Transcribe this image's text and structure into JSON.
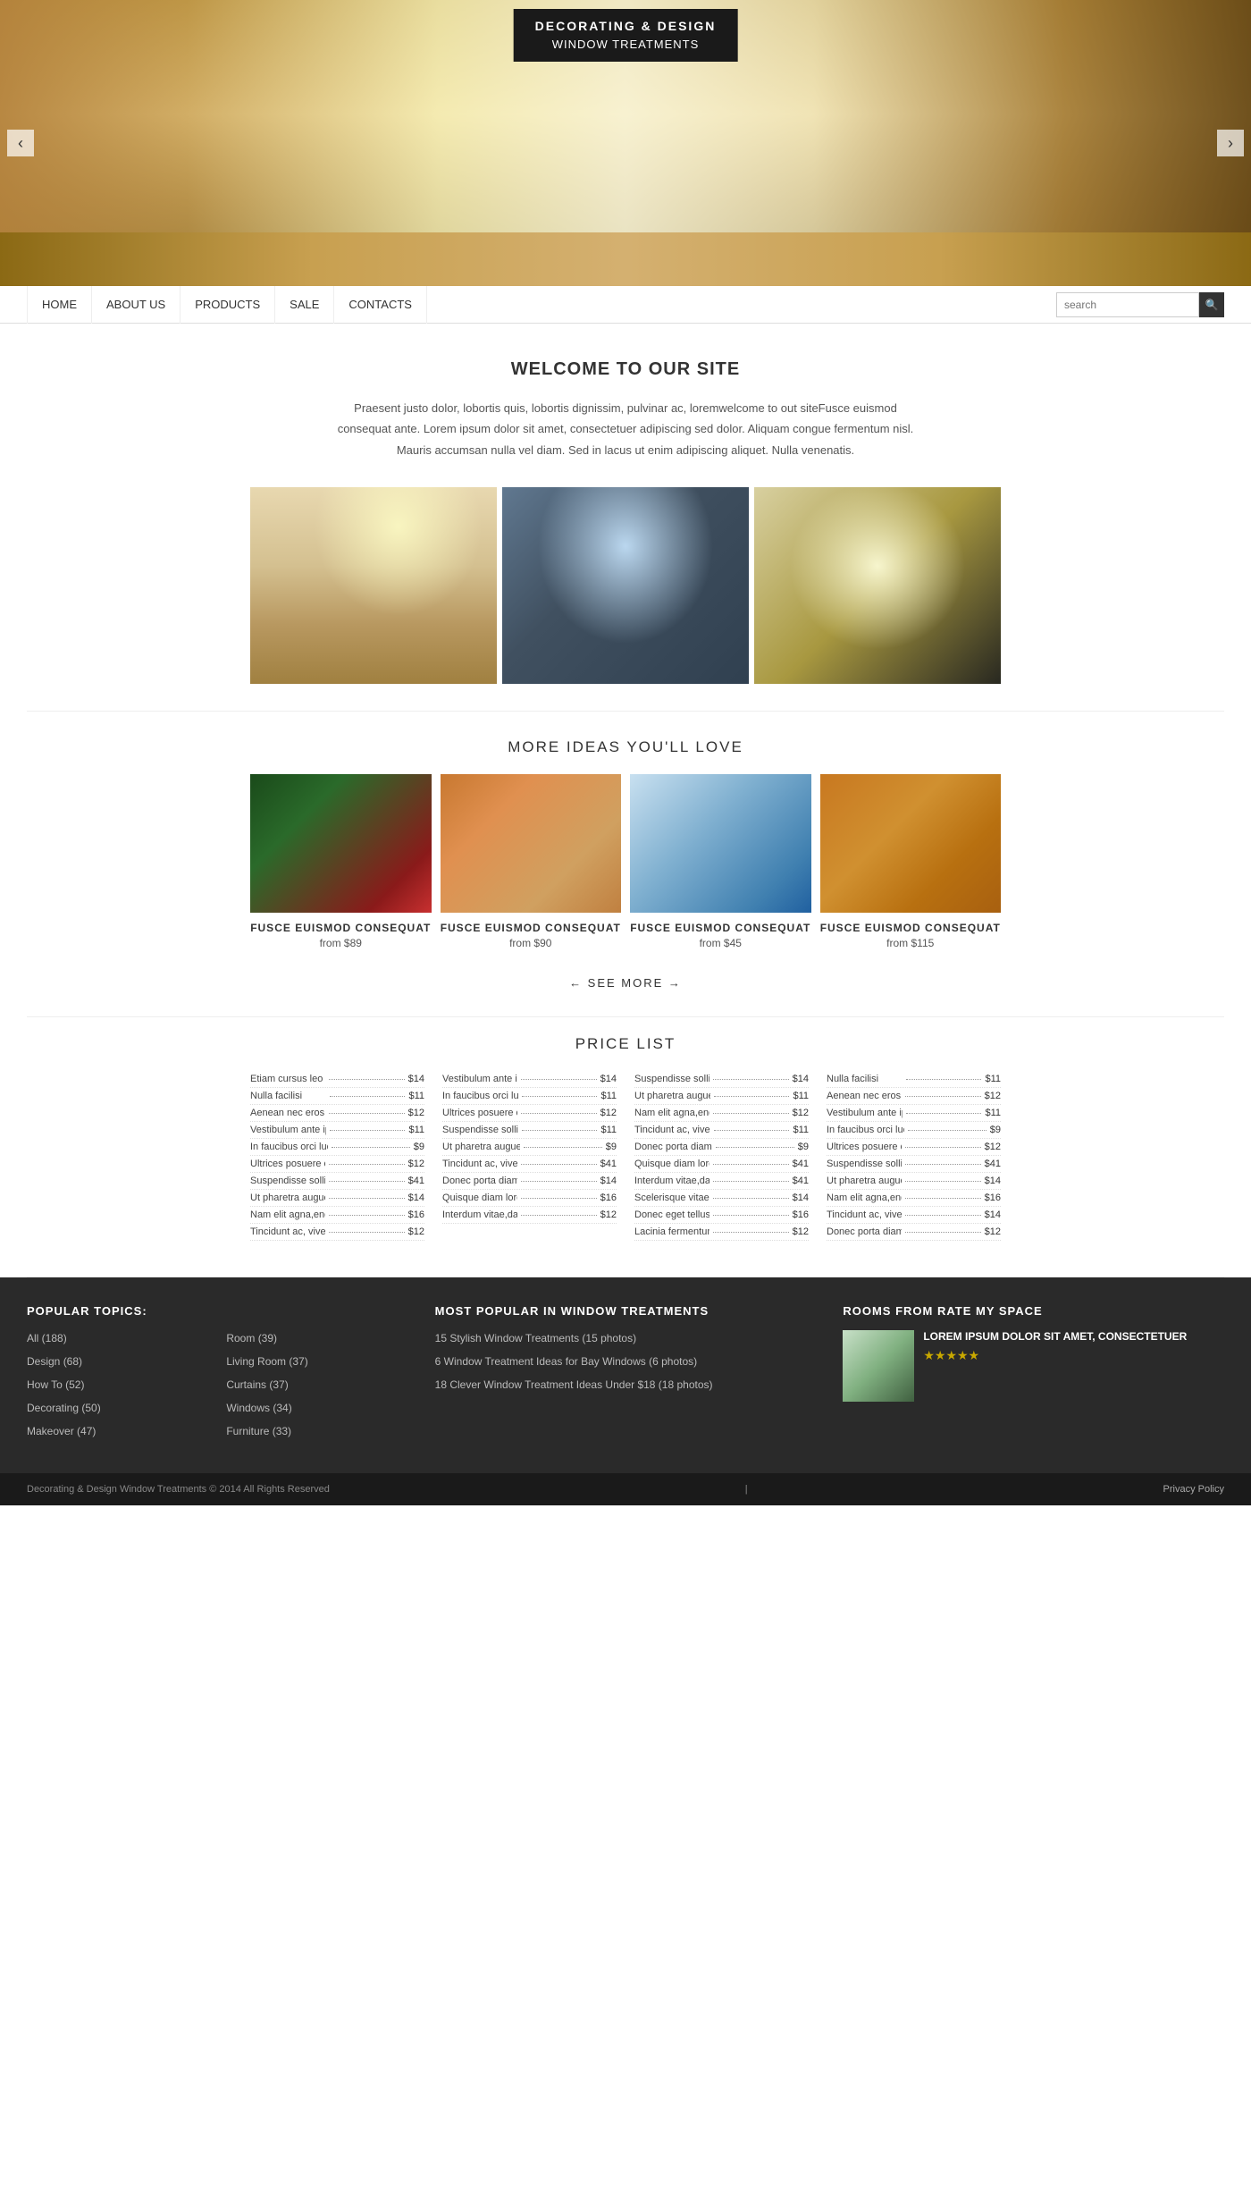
{
  "site": {
    "title_line1": "DECORATING & DESIGN",
    "title_line2": "WINDOW TREATMENTS"
  },
  "nav": {
    "links": [
      "HOME",
      "ABOUT US",
      "PRODUCTS",
      "SALE",
      "CONTACTS"
    ],
    "search_placeholder": "search"
  },
  "hero": {
    "prev_arrow": "‹",
    "next_arrow": "›"
  },
  "welcome": {
    "title": "WELCOME TO OUR SITE",
    "text": "Praesent justo dolor, lobortis quis, lobortis dignissim, pulvinar ac, loremwelcome to out siteFusce euismod consequat ante. Lorem ipsum dolor sit amet, consectetuer adipiscing sed dolor. Aliquam congue fermentum nisl. Mauris accumsan nulla vel diam. Sed in lacus ut enim adipiscing aliquet. Nulla venenatis."
  },
  "gallery_images": [
    {
      "alt": "Room with chandelier and curtains"
    },
    {
      "alt": "Bedroom with sliding doors"
    },
    {
      "alt": "Modern living room"
    }
  ],
  "more_ideas": {
    "title": "MORE IDEAS YOU'LL LOVE",
    "products": [
      {
        "name": "FUSCE EUISMOD CONSEQUAT",
        "price": "from $89"
      },
      {
        "name": "FUSCE EUISMOD CONSEQUAT",
        "price": "from $90"
      },
      {
        "name": "FUSCE EUISMOD CONSEQUAT",
        "price": "from $45"
      },
      {
        "name": "FUSCE EUISMOD CONSEQUAT",
        "price": "from $115"
      }
    ],
    "see_more": "← SEE MORE →"
  },
  "price_list": {
    "title": "PRICE LIST",
    "col1": [
      {
        "name": "Etiam cursus leo vel metus",
        "price": "$14"
      },
      {
        "name": "Nulla facilisi",
        "price": "$11"
      },
      {
        "name": "Aenean nec eros",
        "price": "$12"
      },
      {
        "name": "Vestibulum ante ipsum pri",
        "price": "$11"
      },
      {
        "name": "In faucibus orci luctus et",
        "price": "$9"
      },
      {
        "name": "Ultrices posuere cubilia urae",
        "price": "$12"
      },
      {
        "name": "Suspendisse sollicitudin",
        "price": "$41"
      },
      {
        "name": "Ut pharetra augue nec augue",
        "price": "$14"
      },
      {
        "name": "Nam elit agna,endrerit sit",
        "price": "$16"
      },
      {
        "name": "Tincidunt ac, viverra sed",
        "price": "$12"
      }
    ],
    "col2": [
      {
        "name": "Vestibulum ante ipsum pri",
        "price": "$14"
      },
      {
        "name": "In faucibus orci luctus et",
        "price": "$11"
      },
      {
        "name": "Ultrices posuere cubilia urae",
        "price": "$12"
      },
      {
        "name": "Suspendisse sollicitudin",
        "price": "$11"
      },
      {
        "name": "Ut pharetra augue nec augue",
        "price": "$9"
      },
      {
        "name": "Tincidunt ac, viverra sed",
        "price": "$41"
      },
      {
        "name": "Donec porta diam eu massa",
        "price": "$14"
      },
      {
        "name": "Quisque diam lorem",
        "price": "$16"
      },
      {
        "name": "Interdum vitae,dapibus ac",
        "price": "$12"
      }
    ],
    "col3": [
      {
        "name": "Suspendisse sollicitudin",
        "price": "$14"
      },
      {
        "name": "Ut pharetra augue nec augue",
        "price": "$11"
      },
      {
        "name": "Nam elit agna,endrerit sit",
        "price": "$12"
      },
      {
        "name": "Tincidunt ac, viverra sed",
        "price": "$11"
      },
      {
        "name": "Donec porta diam eu massa",
        "price": "$9"
      },
      {
        "name": "Quisque diam lorem",
        "price": "$41"
      },
      {
        "name": "Interdum vitae,dapibus ac",
        "price": "$41"
      },
      {
        "name": "Scelerisque vitae, pede",
        "price": "$14"
      },
      {
        "name": "Donec eget tellus non erat",
        "price": "$16"
      },
      {
        "name": "Lacinia fermentum",
        "price": "$12"
      }
    ],
    "col4": [
      {
        "name": "Nulla facilisi",
        "price": "$11"
      },
      {
        "name": "Aenean nec eros",
        "price": "$12"
      },
      {
        "name": "Vestibulum ante ipsum pri",
        "price": "$11"
      },
      {
        "name": "In faucibus orci luctus et",
        "price": "$9"
      },
      {
        "name": "Ultrices posuere cubilia urae",
        "price": "$12"
      },
      {
        "name": "Suspendisse sollicitudin",
        "price": "$41"
      },
      {
        "name": "Ut pharetra augue nec augue",
        "price": "$14"
      },
      {
        "name": "Nam elit agna,endrerit sit",
        "price": "$16"
      },
      {
        "name": "Tincidunt ac, viverra sed",
        "price": "$14"
      },
      {
        "name": "Donec porta diam eu massa",
        "price": "$12"
      }
    ]
  },
  "footer": {
    "popular_topics": {
      "title": "POPULAR TOPICS:",
      "col1": [
        {
          "label": "All (188)"
        },
        {
          "label": "Design (68)"
        },
        {
          "label": "How To (52)"
        },
        {
          "label": "Decorating (50)"
        },
        {
          "label": "Makeover (47)"
        }
      ],
      "col2": [
        {
          "label": "Room (39)"
        },
        {
          "label": "Living Room (37)"
        },
        {
          "label": "Curtains (37)"
        },
        {
          "label": "Windows (34)"
        },
        {
          "label": "Furniture (33)"
        }
      ]
    },
    "most_popular": {
      "title": "MOST POPULAR IN WINDOW TREATMENTS",
      "links": [
        "15 Stylish Window Treatments (15 photos)",
        "6 Window Treatment Ideas for Bay Windows (6 photos)",
        "18 Clever Window Treatment Ideas Under $18 (18 photos)"
      ]
    },
    "rooms": {
      "title": "ROOMS FROM RATE MY SPACE",
      "room_title": "LOREM IPSUM DOLOR SIT AMET, CONSECTETUER",
      "stars": "★★★★★"
    },
    "bottom": {
      "copyright": "Decorating & Design Window Treatments © 2014 All Rights Reserved",
      "privacy": "Privacy Policy"
    }
  }
}
